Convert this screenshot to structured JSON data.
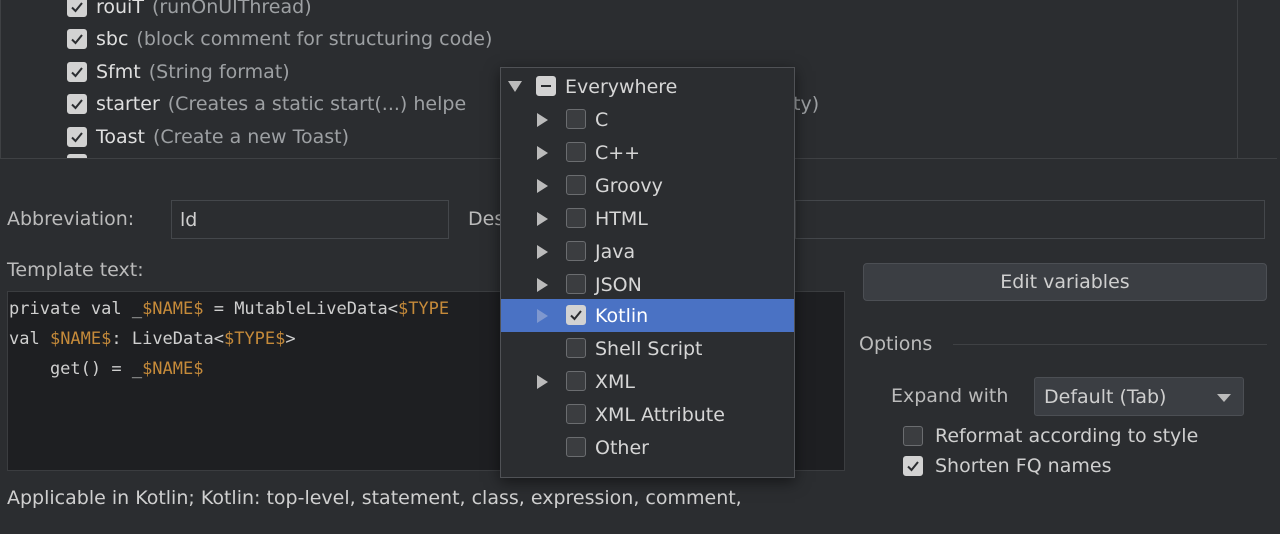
{
  "templates": [
    {
      "abbr": "rouiT",
      "desc": "(runOnUIThread)",
      "checked": true
    },
    {
      "abbr": "sbc",
      "desc": "(block comment for structuring code)",
      "checked": true
    },
    {
      "abbr": "Sfmt",
      "desc": "(String format)",
      "checked": true
    },
    {
      "abbr": "starter",
      "desc": "(Creates a static start(...) helpe",
      "desc_tail": "ty)",
      "checked": true
    },
    {
      "abbr": "Toast",
      "desc": "(Create a new Toast)",
      "checked": true
    }
  ],
  "form": {
    "abbreviation_label": "Abbreviation:",
    "abbreviation_value": "ld",
    "description_label": "Des",
    "template_text_label": "Template text:",
    "edit_variables_label": "Edit variables"
  },
  "editor": {
    "line1": {
      "pre": "private val _",
      "var1": "$NAME$",
      "mid": " = MutableLiveData<",
      "var2": "$TYPE"
    },
    "line2": {
      "pre": "val ",
      "var1": "$NAME$",
      "mid": ": LiveData<",
      "var2": "$TYPE$",
      "post": ">"
    },
    "line3": {
      "pre": "    get() = _",
      "var1": "$NAME$"
    }
  },
  "options": {
    "title": "Options",
    "expand_with_label": "Expand with",
    "expand_with_value": "Default (Tab)",
    "reformat_label": "Reformat according to style",
    "reformat_checked": false,
    "shorten_label": "Shorten FQ names",
    "shorten_checked": true
  },
  "applicable_text": "Applicable in Kotlin; Kotlin: top-level, statement, class, expression, comment,",
  "context_popup": {
    "items": [
      {
        "label": "Everywhere",
        "state": "indeterminate",
        "expandable": true,
        "expanded": true,
        "level": 0
      },
      {
        "label": "C",
        "state": "unchecked",
        "expandable": true,
        "level": 1
      },
      {
        "label": "C++",
        "state": "unchecked",
        "expandable": true,
        "level": 1
      },
      {
        "label": "Groovy",
        "state": "unchecked",
        "expandable": true,
        "level": 1
      },
      {
        "label": "HTML",
        "state": "unchecked",
        "expandable": true,
        "level": 1
      },
      {
        "label": "Java",
        "state": "unchecked",
        "expandable": true,
        "level": 1
      },
      {
        "label": "JSON",
        "state": "unchecked",
        "expandable": true,
        "level": 1
      },
      {
        "label": "Kotlin",
        "state": "checked",
        "expandable": true,
        "level": 1,
        "selected": true
      },
      {
        "label": "Shell Script",
        "state": "unchecked",
        "expandable": false,
        "level": 1
      },
      {
        "label": "XML",
        "state": "unchecked",
        "expandable": true,
        "level": 1
      },
      {
        "label": "XML Attribute",
        "state": "unchecked",
        "expandable": false,
        "level": 1
      },
      {
        "label": "Other",
        "state": "unchecked",
        "expandable": false,
        "level": 1
      }
    ]
  },
  "colors": {
    "background": "#2b2d30",
    "selection": "#4a72c4",
    "variable": "#c58a3a",
    "editor_bg": "#1e1f22"
  }
}
